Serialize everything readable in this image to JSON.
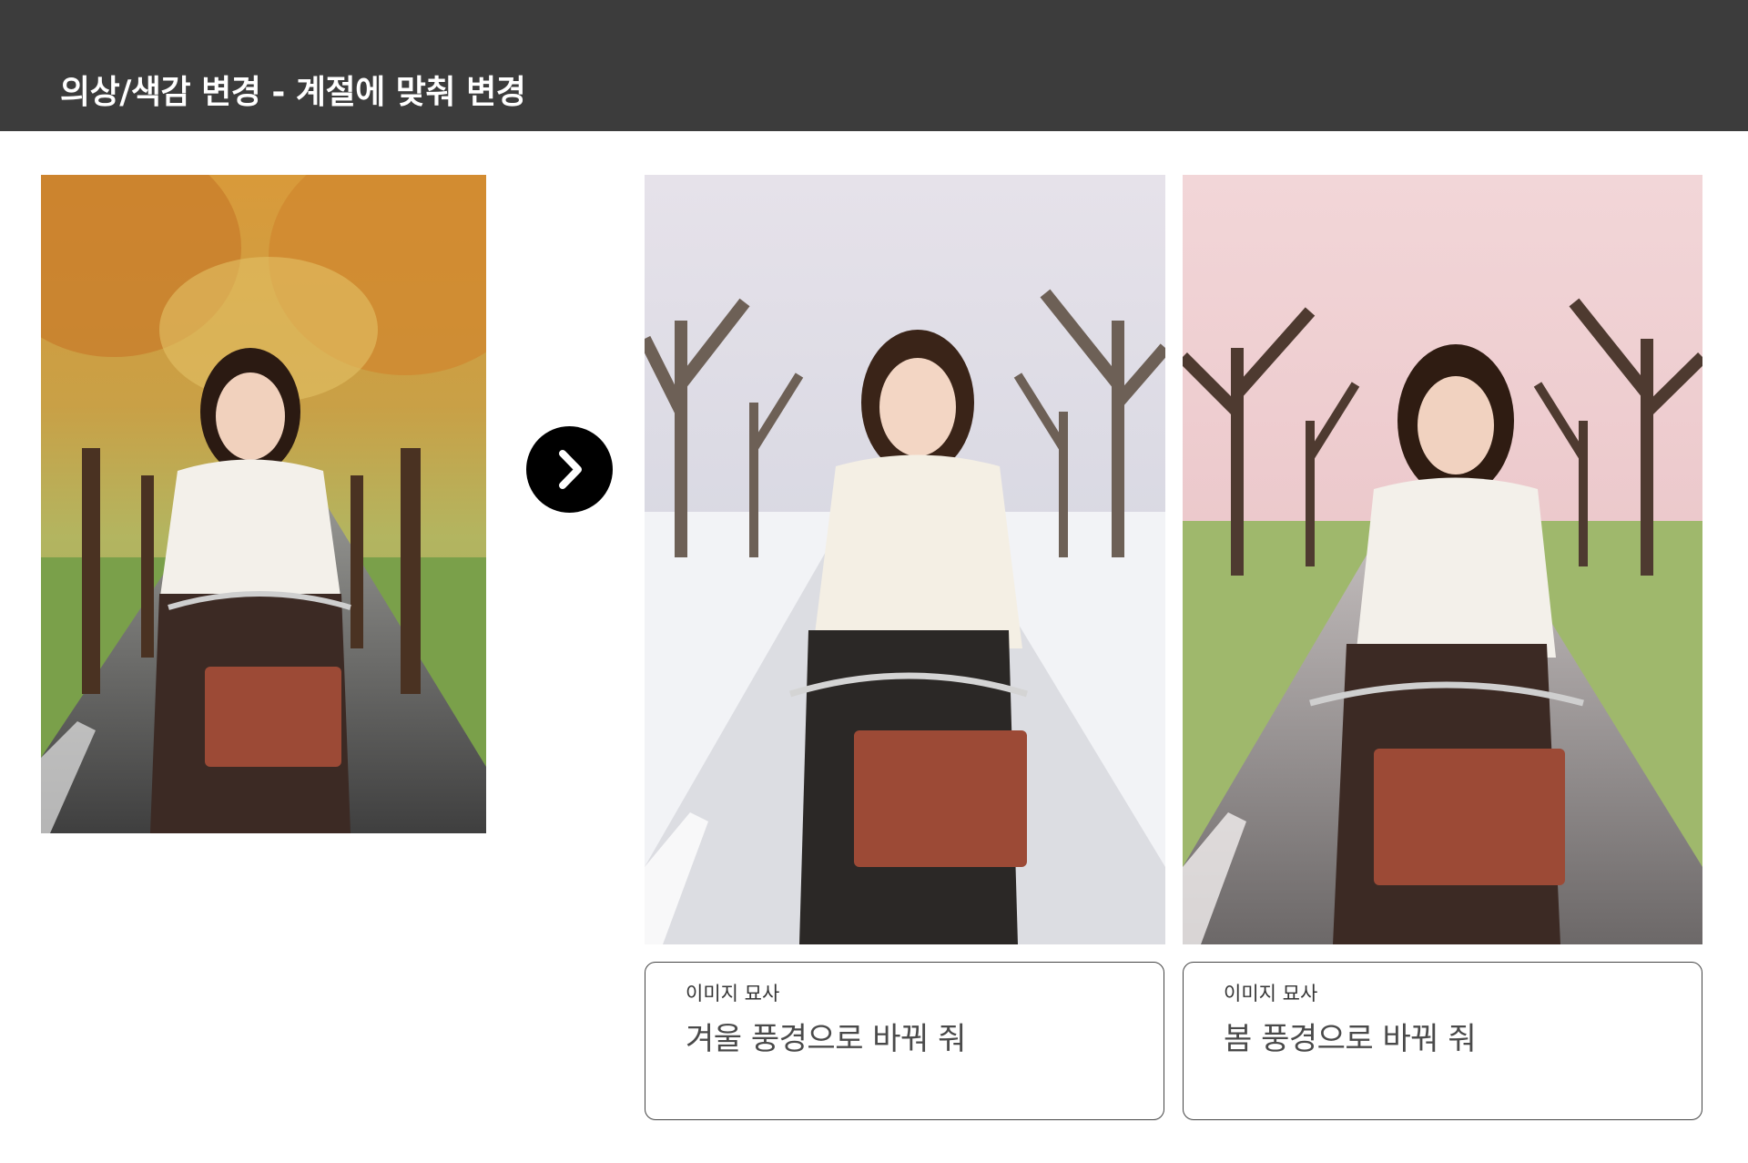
{
  "header": {
    "title": "의상/색감 변경 - 계절에 맞춰 변경"
  },
  "colors": {
    "header_bg": "#3c3c3c",
    "arrow_bg": "#000000",
    "border": "#444444"
  },
  "arrow": {
    "icon": "chevron-right-icon"
  },
  "captions": [
    {
      "label": "이미지 묘사",
      "text": "겨울 풍경으로 바꿔 줘"
    },
    {
      "label": "이미지 묘사",
      "text": "봄 풍경으로 바꿔 줘"
    }
  ]
}
